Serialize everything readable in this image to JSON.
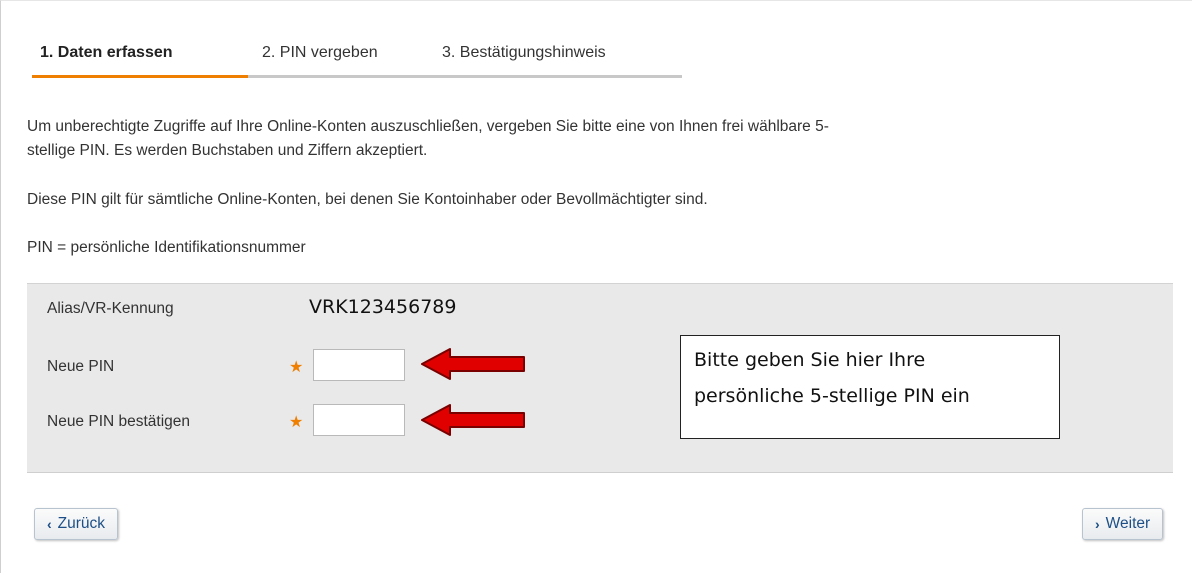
{
  "tabs": [
    {
      "label": "1. Daten erfassen",
      "active": true
    },
    {
      "label": "2. PIN vergeben",
      "active": false
    },
    {
      "label": "3. Bestätigungshinweis",
      "active": false
    }
  ],
  "intro": {
    "line1": "Um unberechtigte Zugriffe auf Ihre Online-Konten auszuschließen, vergeben Sie bitte eine von Ihnen frei wählbare 5-",
    "line2": "stellige PIN. Es werden Buchstaben und Ziffern akzeptiert.",
    "para2": "Diese PIN gilt für sämtliche Online-Konten, bei denen Sie Kontoinhaber oder Bevollmächtigter sind.",
    "para3": "PIN = persönliche Identifikationsnummer"
  },
  "form": {
    "alias_label": "Alias/VR-Kennung",
    "alias_value": "VRK123456789",
    "new_pin_label": "Neue PIN",
    "confirm_pin_label": "Neue PIN bestätigen",
    "required_marker": "★",
    "new_pin_value": "",
    "confirm_pin_value": ""
  },
  "callout": {
    "line1": "Bitte geben Sie hier Ihre",
    "line2": "persönliche 5-stellige PIN ein"
  },
  "buttons": {
    "back_label": "Zurück",
    "back_chevron": "‹",
    "next_label": "Weiter",
    "next_chevron": "›"
  },
  "colors": {
    "accent": "#ee7f00",
    "arrow": "#e00000",
    "panel": "#e9e9e9",
    "button_text": "#1d4f86"
  }
}
